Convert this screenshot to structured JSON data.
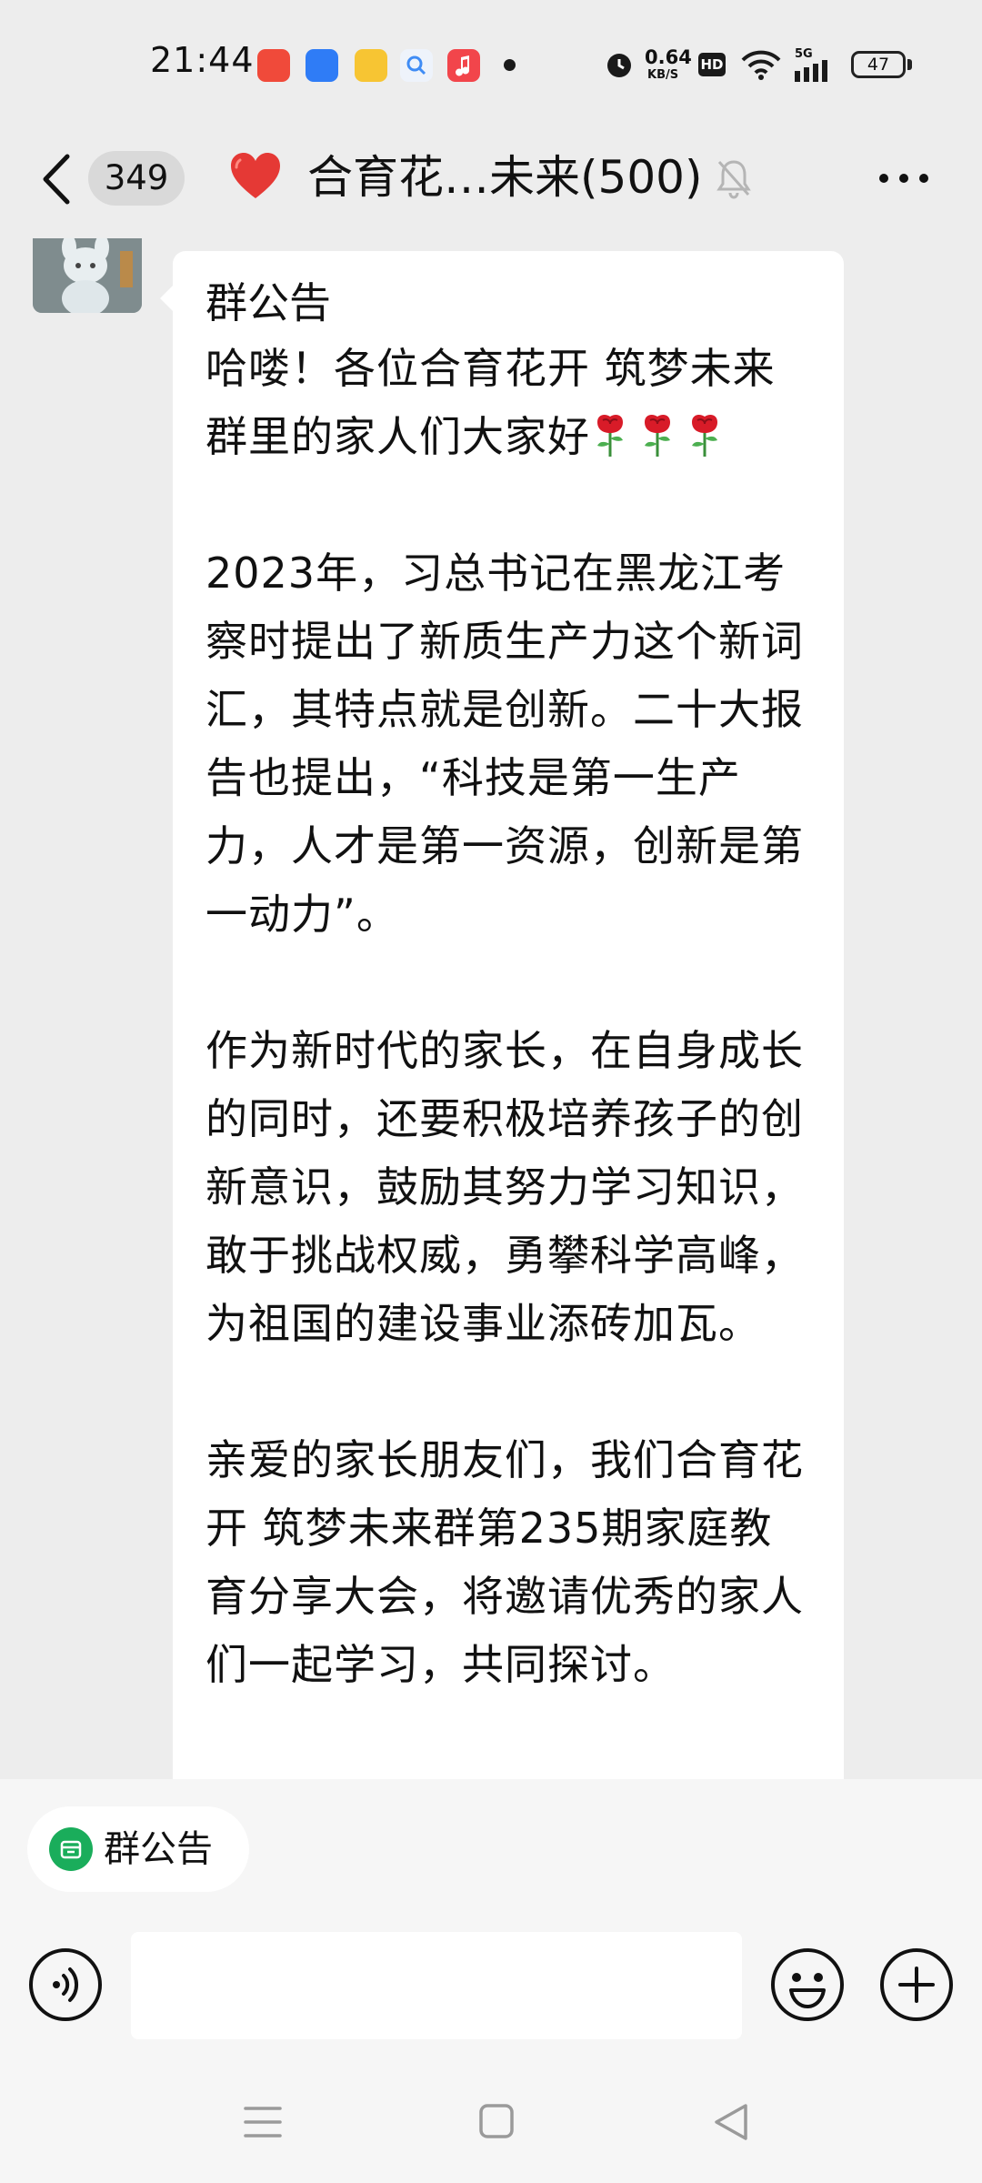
{
  "status_bar": {
    "time": "21:44",
    "net_speed_value": "0.64",
    "net_speed_unit": "KB/S",
    "hd_label": "HD",
    "network_type": "5G",
    "battery_level": "47",
    "app_icons": [
      {
        "name": "app-icon-red",
        "color": "#f04a3a"
      },
      {
        "name": "app-icon-blue",
        "color": "#2f7cf6"
      },
      {
        "name": "app-icon-yellow",
        "color": "#f7c533"
      },
      {
        "name": "app-icon-search",
        "color": "#3f8cf5"
      },
      {
        "name": "app-icon-music",
        "color": "#f2454b"
      }
    ]
  },
  "header": {
    "unread_count": "349",
    "title": "合育花…未来(500)",
    "icons": [
      "back-arrow-icon",
      "heart-icon",
      "mute-bell-icon",
      "more-dots-icon"
    ]
  },
  "message": {
    "title": "群公告",
    "greeting": "哈喽！各位合育花开 筑梦未来群里的家人们大家好",
    "rose_icon_count": 3,
    "paragraphs": [
      "2023年，习总书记在黑龙江考察时提出了新质生产力这个新词汇，其特点就是创新。二十大报告也提出，“科技是第一生产力，人才是第一资源，创新是第一动力”。",
      "作为新时代的家长，在自身成长的同时，还要积极培养孩子的创新意识，鼓励其努力学习知识，敢于挑战权威，勇攀科学高峰，为祖国的建设事业添砖加瓦。",
      "亲爱的家长朋友们，我们合育花开 筑梦未来群第235期家庭教育分享大会，将邀请优秀的家人们一起学习，共同探讨。"
    ]
  },
  "bottom": {
    "notice_chip_label": "群公告",
    "input_value": "",
    "input_placeholder": "",
    "accent_color": "#1aad5b"
  },
  "nav": {
    "icons": [
      "menu-icon",
      "home-square-icon",
      "back-triangle-icon"
    ]
  }
}
